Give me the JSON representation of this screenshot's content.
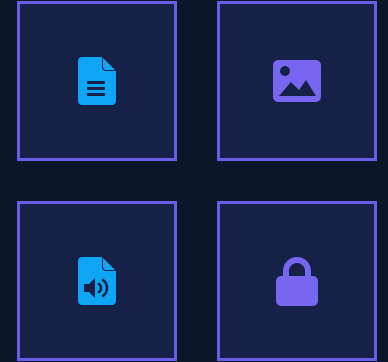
{
  "tiles": [
    {
      "icon": "document-icon",
      "color": "#0ea5f4"
    },
    {
      "icon": "image-icon",
      "color": "#7866f0"
    },
    {
      "icon": "audio-file-icon",
      "color": "#0ea5f4"
    },
    {
      "icon": "lock-icon",
      "color": "#7866f0"
    }
  ],
  "colors": {
    "background": "#0b1628",
    "tile_fill": "#152147",
    "tile_border": "#6a5de8"
  }
}
